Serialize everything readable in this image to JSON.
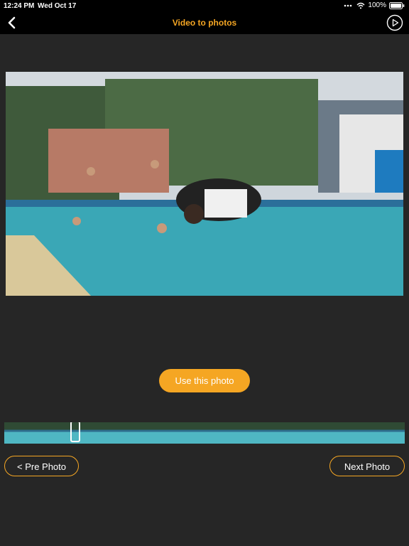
{
  "status_bar": {
    "time": "12:24 PM",
    "date": "Wed Oct 17",
    "battery": "100%"
  },
  "nav": {
    "title": "Video to photos",
    "back_icon": "chevron-left-icon",
    "play_icon": "play-circle-icon"
  },
  "actions": {
    "use_photo": "Use this photo",
    "pre_photo": "< Pre Photo",
    "next_photo": "Next Photo"
  },
  "colors": {
    "accent": "#f5a623",
    "background": "#262626",
    "bar": "#000000"
  }
}
